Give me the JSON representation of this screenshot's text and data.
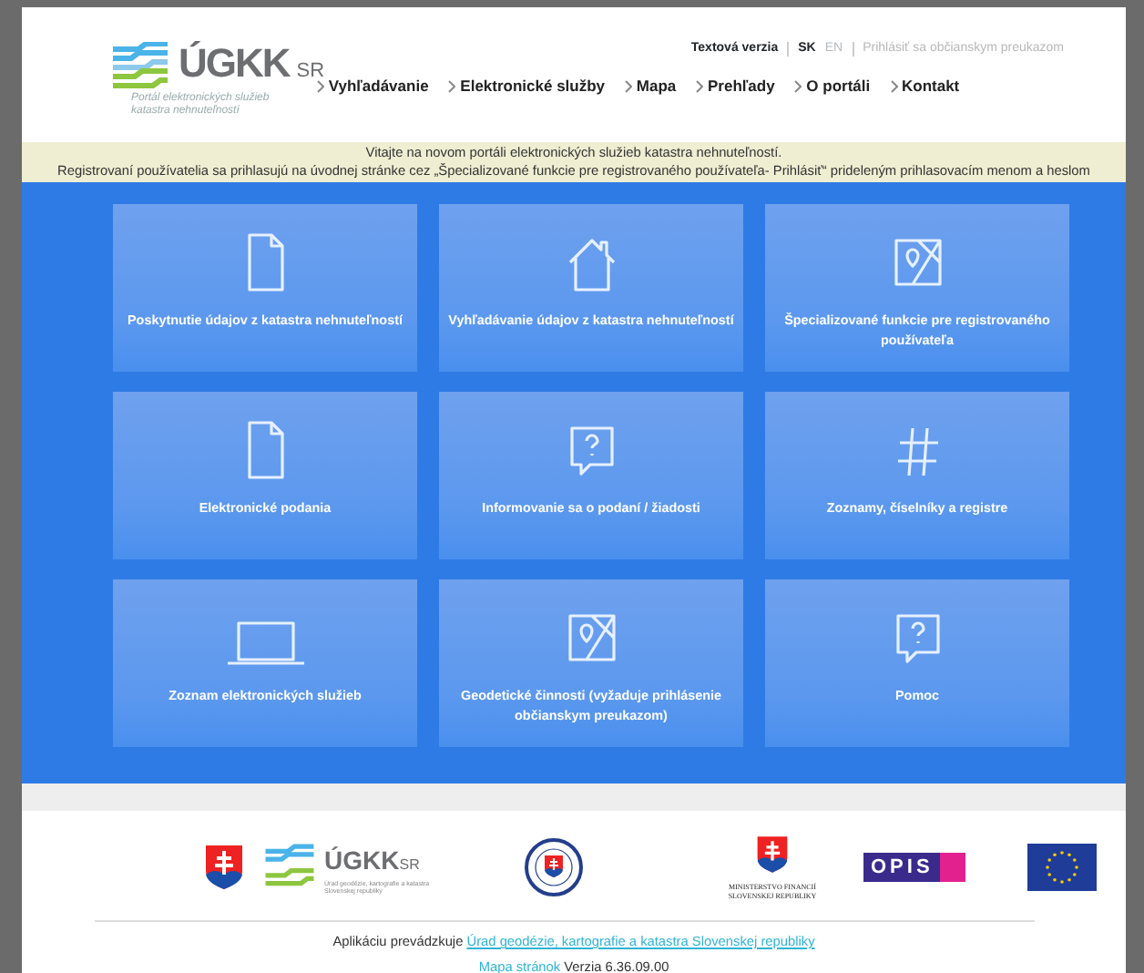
{
  "header": {
    "logo": {
      "name": "ÚGKK",
      "suffix": "SR",
      "tagline": "Portál elektronických služieb katastra nehnuteľností"
    },
    "top_links": [
      {
        "label": "Textová verzia"
      }
    ],
    "languages": [
      {
        "label": "SK",
        "selected": true
      },
      {
        "label": "EN",
        "selected": false
      }
    ],
    "login_link": "Prihlásiť sa občianskym preukazom",
    "nav": [
      {
        "label": "Vyhľadávanie"
      },
      {
        "label": "Elektronické služby"
      },
      {
        "label": "Mapa"
      },
      {
        "label": "Prehľady"
      },
      {
        "label": "O portáli"
      },
      {
        "label": "Kontakt"
      }
    ]
  },
  "notice": [
    "Vitajte na novom portáli elektronických služieb katastra nehnuteľností.",
    "Registrovaní používatelia sa prihlasujú na úvodnej stránke cez „Špecializované funkcie pre registrovaného používateľa- Prihlásiť“ prideleným prihlasovacím menom a heslom"
  ],
  "tiles": [
    {
      "kind": "file",
      "label": "Poskytnutie údajov z katastra nehnuteľností"
    },
    {
      "kind": "house",
      "label": "Vyhľadávanie údajov z katastra nehnuteľností"
    },
    {
      "kind": "map",
      "label": "Špecializované funkcie pre registrovaného používateľa"
    },
    {
      "kind": "file",
      "label": "Elektronické podania"
    },
    {
      "kind": "question",
      "label": "Informovanie sa o podaní / žiadosti"
    },
    {
      "kind": "hash",
      "label": "Zoznamy, číselníky a registre"
    },
    {
      "kind": "laptop",
      "label": "Zoznam elektronických služieb"
    },
    {
      "kind": "map",
      "label": "Geodetické činnosti (vyžaduje prihlásenie občianskym preukazom)"
    },
    {
      "kind": "question",
      "label": "Pomoc"
    }
  ],
  "footer": {
    "logos": [
      {
        "kind": "coat"
      },
      {
        "kind": "ugkk",
        "name": "ÚGKK",
        "suffix": "SR",
        "caption": "Úrad geodézie, kartografie a katastra Slovenskej republiky"
      },
      {
        "kind": "seal"
      },
      {
        "kind": "ministry",
        "caption": "MINISTERSTVO FINANCIÍ SLOVENSKEJ REPUBLIKY"
      },
      {
        "kind": "opis",
        "name": "OPIS"
      },
      {
        "kind": "eu"
      }
    ],
    "operator_text": "Aplikáciu prevádzkuje",
    "operator_link": "Úrad geodézie, kartografie a katastra Slovenskej republiky",
    "sitemap_link": "Mapa stránok",
    "version": "Verzia 6.36.09.00"
  }
}
